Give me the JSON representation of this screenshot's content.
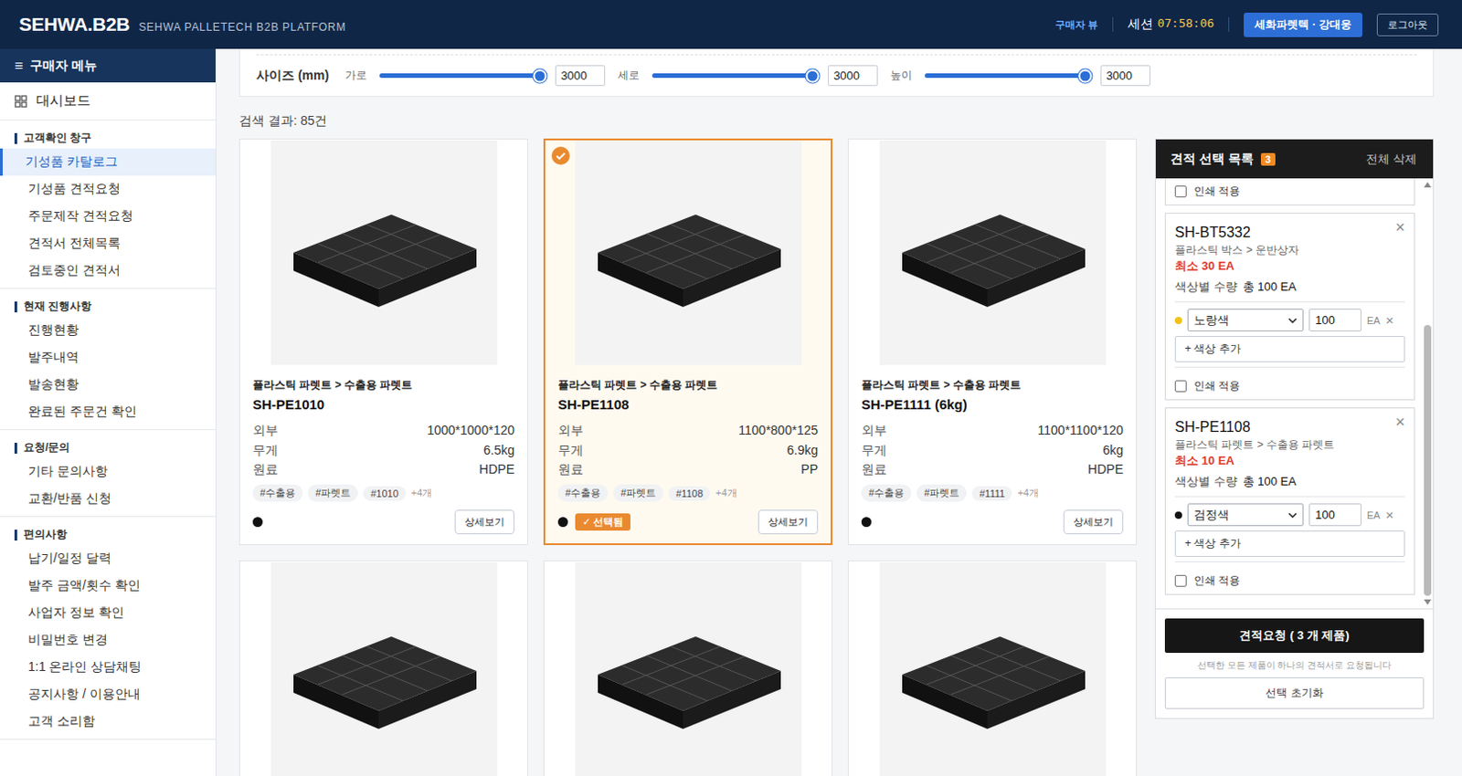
{
  "header": {
    "logo": "SEHWA.B2B",
    "subtitle": "SEHWA PALLETECH B2B PLATFORM",
    "view_label": "구매자 뷰",
    "session_label": "세션",
    "session_time": "07:58:06",
    "user_button": "세화파렛텍 · 강대웅",
    "logout": "로그아웃"
  },
  "sidebar": {
    "menu_icon": "≡",
    "title": "구매자 메뉴",
    "dashboard": "대시보드",
    "sections": [
      {
        "title": "고객확인 창구",
        "items": [
          {
            "label": "기성품 카탈로그",
            "selected": true
          },
          {
            "label": "기성품 견적요청",
            "selected": false
          },
          {
            "label": "주문제작 견적요청",
            "selected": false
          },
          {
            "label": "견적서 전체목록",
            "selected": false
          },
          {
            "label": "검토중인 견적서",
            "selected": false
          }
        ]
      },
      {
        "title": "현재 진행사항",
        "items": [
          {
            "label": "진행현황",
            "selected": false
          },
          {
            "label": "발주내역",
            "selected": false
          },
          {
            "label": "발송현황",
            "selected": false
          },
          {
            "label": "완료된 주문건 확인",
            "selected": false
          }
        ]
      },
      {
        "title": "요청/문의",
        "items": [
          {
            "label": "기타 문의사항",
            "selected": false
          },
          {
            "label": "교환/반품 신청",
            "selected": false
          }
        ]
      },
      {
        "title": "편의사항",
        "items": [
          {
            "label": "납기/일정 달력",
            "selected": false
          },
          {
            "label": "발주 금액/횟수 확인",
            "selected": false
          },
          {
            "label": "사업자 정보 확인",
            "selected": false
          },
          {
            "label": "비밀번호 변경",
            "selected": false
          },
          {
            "label": "1:1 온라인 상담채팅",
            "selected": false
          },
          {
            "label": "공지사항 / 이용안내",
            "selected": false
          },
          {
            "label": "고객 소리함",
            "selected": false
          }
        ]
      }
    ]
  },
  "filters": {
    "label": "사이즈 (mm)",
    "sliders": [
      {
        "label": "가로",
        "level": 1,
        "value": "3000"
      },
      {
        "label": "세로",
        "level": 1,
        "value": "3000"
      },
      {
        "label": "높이",
        "level": 1,
        "value": "3000"
      }
    ]
  },
  "results": "검색 결과: 85건",
  "products": [
    {
      "kind": "full",
      "category": "플라스틱 파렛트 > 수출용 파렛트",
      "name": "SH-PE1010",
      "specs": [
        {
          "label": "외부",
          "value": "1000*1000*120"
        },
        {
          "label": "무게",
          "value": "6.5kg"
        },
        {
          "label": "원료",
          "value": "HDPE"
        }
      ],
      "tags": [
        "#수출용",
        "#파렛트",
        "#1010"
      ],
      "more": "+4개",
      "color": "#111111",
      "selected": false,
      "detail": "상세보기"
    },
    {
      "kind": "full",
      "category": "플라스틱 파렛트 > 수출용 파렛트",
      "name": "SH-PE1108",
      "specs": [
        {
          "label": "외부",
          "value": "1100*800*125"
        },
        {
          "label": "무게",
          "value": "6.9kg"
        },
        {
          "label": "원료",
          "value": "PP"
        }
      ],
      "tags": [
        "#수출용",
        "#파렛트",
        "#1108"
      ],
      "more": "+4개",
      "color": "#111111",
      "selected": true,
      "badge": "✓ 선택됨",
      "detail": "상세보기"
    },
    {
      "kind": "full",
      "category": "플라스틱 파렛트 > 수출용 파렛트",
      "name": "SH-PE1111 (6kg)",
      "specs": [
        {
          "label": "외부",
          "value": "1100*1100*120"
        },
        {
          "label": "무게",
          "value": "6kg"
        },
        {
          "label": "원료",
          "value": "HDPE"
        }
      ],
      "tags": [
        "#수출용",
        "#파렛트",
        "#1111"
      ],
      "more": "+4개",
      "color": "#111111",
      "selected": false,
      "detail": "상세보기"
    },
    {
      "kind": "image",
      "selected": false
    },
    {
      "kind": "image",
      "selected": false
    },
    {
      "kind": "image",
      "selected": false
    }
  ],
  "quote": {
    "title": "견적 선택 목록",
    "count": "3",
    "clear_all": "전체 삭제",
    "scroll": {
      "level": 1
    },
    "items": [
      {
        "kind": "partial",
        "print": {
          "label": "인쇄 적용",
          "checked": false
        }
      },
      {
        "kind": "full",
        "name": "SH-BT5332",
        "close": "×",
        "category": "플라스틱 박스 > 운반상자",
        "min": "최소 30 EA",
        "qty_label": "색상별 수량",
        "total": "총 100 EA",
        "colors": [
          {
            "name": "노랑색",
            "color": "#f2c21b",
            "qty": "100",
            "unit": "EA",
            "remove": "×"
          }
        ],
        "add_color": "+ 색상 추가",
        "print": {
          "label": "인쇄 적용",
          "checked": false
        }
      },
      {
        "kind": "full",
        "name": "SH-PE1108",
        "close": "×",
        "category": "플라스틱 파렛트 > 수출용 파렛트",
        "min": "최소 10 EA",
        "qty_label": "색상별 수량",
        "total": "총 100 EA",
        "colors": [
          {
            "name": "검정색",
            "color": "#111111",
            "qty": "100",
            "unit": "EA",
            "remove": "×"
          }
        ],
        "add_color": "+ 색상 추가",
        "print": {
          "label": "인쇄 적용",
          "checked": false
        }
      }
    ],
    "submit": "견적요청 ( 3 개 제품)",
    "note": "선택한 모든 제품이 하나의 견적서로 요청됩니다",
    "reset": "선택 초기화"
  }
}
